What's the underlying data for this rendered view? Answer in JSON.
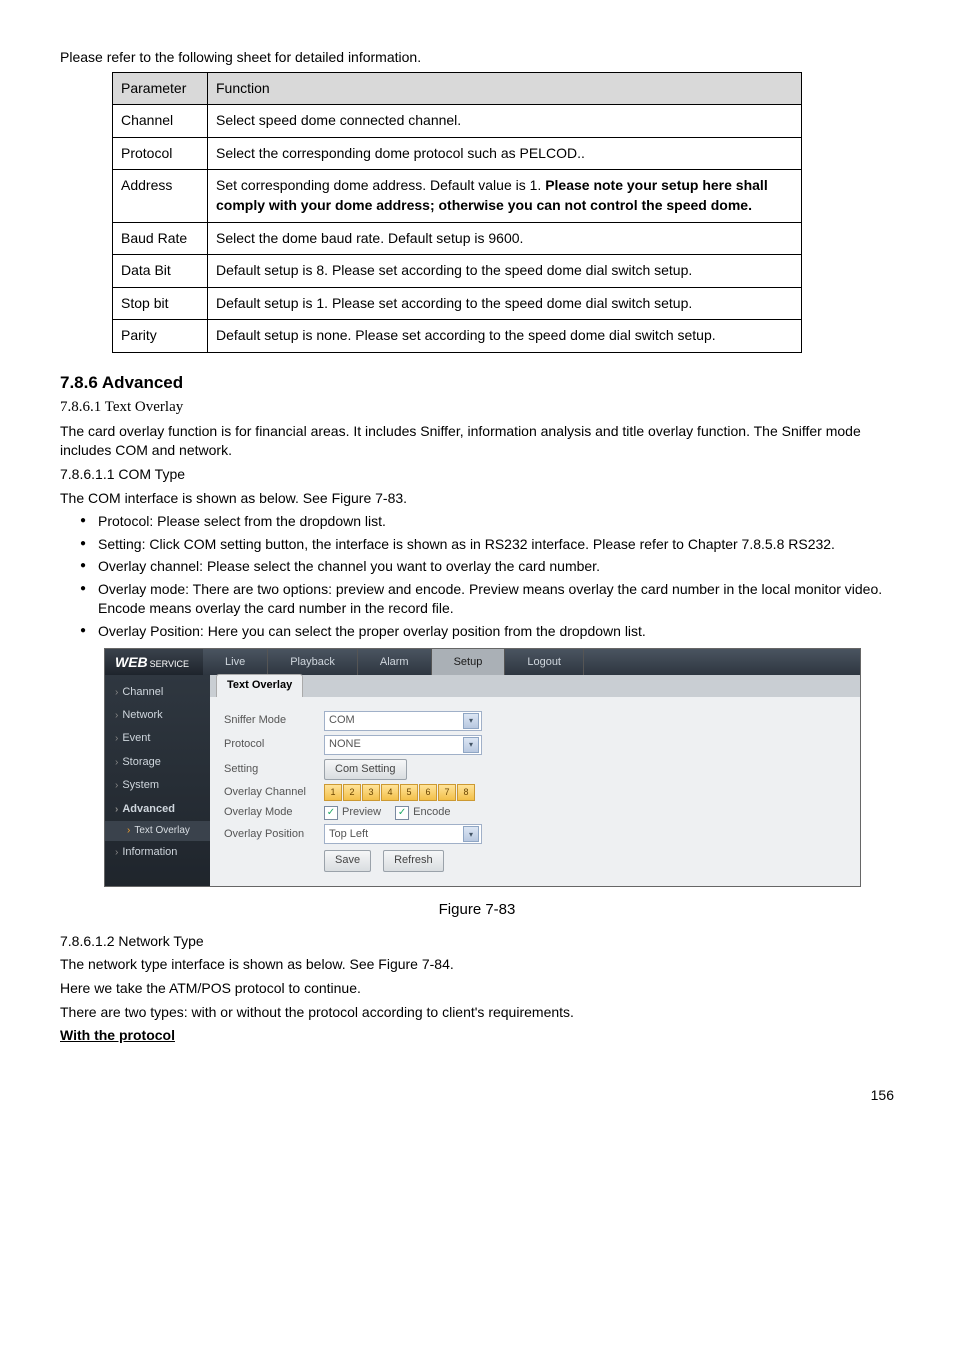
{
  "intro": "Please refer to the following sheet for detailed information.",
  "table_header": {
    "c1": "Parameter",
    "c2": "Function"
  },
  "rows": [
    {
      "p": "Channel",
      "f": "Select speed dome connected channel."
    },
    {
      "p": "Protocol",
      "f": "Select the corresponding dome protocol such as PELCOD.."
    },
    {
      "p": "Address",
      "f_pre": "Set corresponding dome address. Default value is 1. ",
      "f_bold": "Please note your setup here shall comply with your dome address; otherwise you can not control the speed dome."
    },
    {
      "p": "Baud Rate",
      "f": "Select the dome baud rate. Default setup is 9600."
    },
    {
      "p": "Data Bit",
      "f": "Default setup is 8. Please set according to the speed dome dial switch setup."
    },
    {
      "p": "Stop bit",
      "f": "Default setup is 1. Please set according to the speed dome dial switch setup."
    },
    {
      "p": "Parity",
      "f": "Default setup is none. Please set according to the speed dome dial switch setup."
    }
  ],
  "section_title": "7.8.6   Advanced",
  "sub1": "7.8.6.1 Text Overlay",
  "para1a": "The card overlay function is for financial areas. It includes Sniffer, information analysis and title overlay function. The Sniffer mode includes COM and network.",
  "numhead1": "7.8.6.1.1    COM Type",
  "para1b": "The COM interface is shown as below. See Figure 7-83.",
  "bullets": [
    " Protocol: Please select from the dropdown list.",
    "Setting: Click COM setting button, the interface is shown as in RS232 interface. Please refer to Chapter 7.8.5.8 RS232.",
    "Overlay channel: Please select the channel you want to overlay the card number.",
    "Overlay mode: There are two options: preview and encode. Preview means overlay the card number in the local monitor video. Encode means overlay the card number in the record file.",
    "Overlay Position: Here you can select the proper overlay position from the dropdown list."
  ],
  "ws": {
    "logo_main": "WEB",
    "logo_sub": "SERVICE",
    "tabs": [
      "Live",
      "Playback",
      "Alarm",
      "Setup",
      "Logout"
    ],
    "active_tab_index": 3,
    "side": [
      "Channel",
      "Network",
      "Event",
      "Storage",
      "System",
      "Advanced"
    ],
    "side_sub": "Text Overlay",
    "side_after": [
      "Information"
    ],
    "main_tab": "Text Overlay",
    "labels": {
      "sniffer": "Sniffer Mode",
      "protocol": "Protocol",
      "setting": "Setting",
      "ovch": "Overlay Channel",
      "ovmode": "Overlay Mode",
      "ovpos": "Overlay Position"
    },
    "values": {
      "sniffer": "COM",
      "protocol": "NONE",
      "setting_btn": "Com Setting",
      "channels": [
        "1",
        "2",
        "3",
        "4",
        "5",
        "6",
        "7",
        "8"
      ],
      "preview": "Preview",
      "encode": "Encode",
      "ovpos": "Top Left",
      "save": "Save",
      "refresh": "Refresh"
    }
  },
  "fig_caption": "Figure 7-83",
  "numhead2": "7.8.6.1.2    Network Type",
  "para2a": "The network type interface is shown as below. See Figure 7-84.",
  "para2b": "Here we take the ATM/POS protocol to continue.",
  "para2c": "There are two types: with or without the protocol according to client's requirements.",
  "with_protocol": "With the protocol",
  "pagenum": "156"
}
